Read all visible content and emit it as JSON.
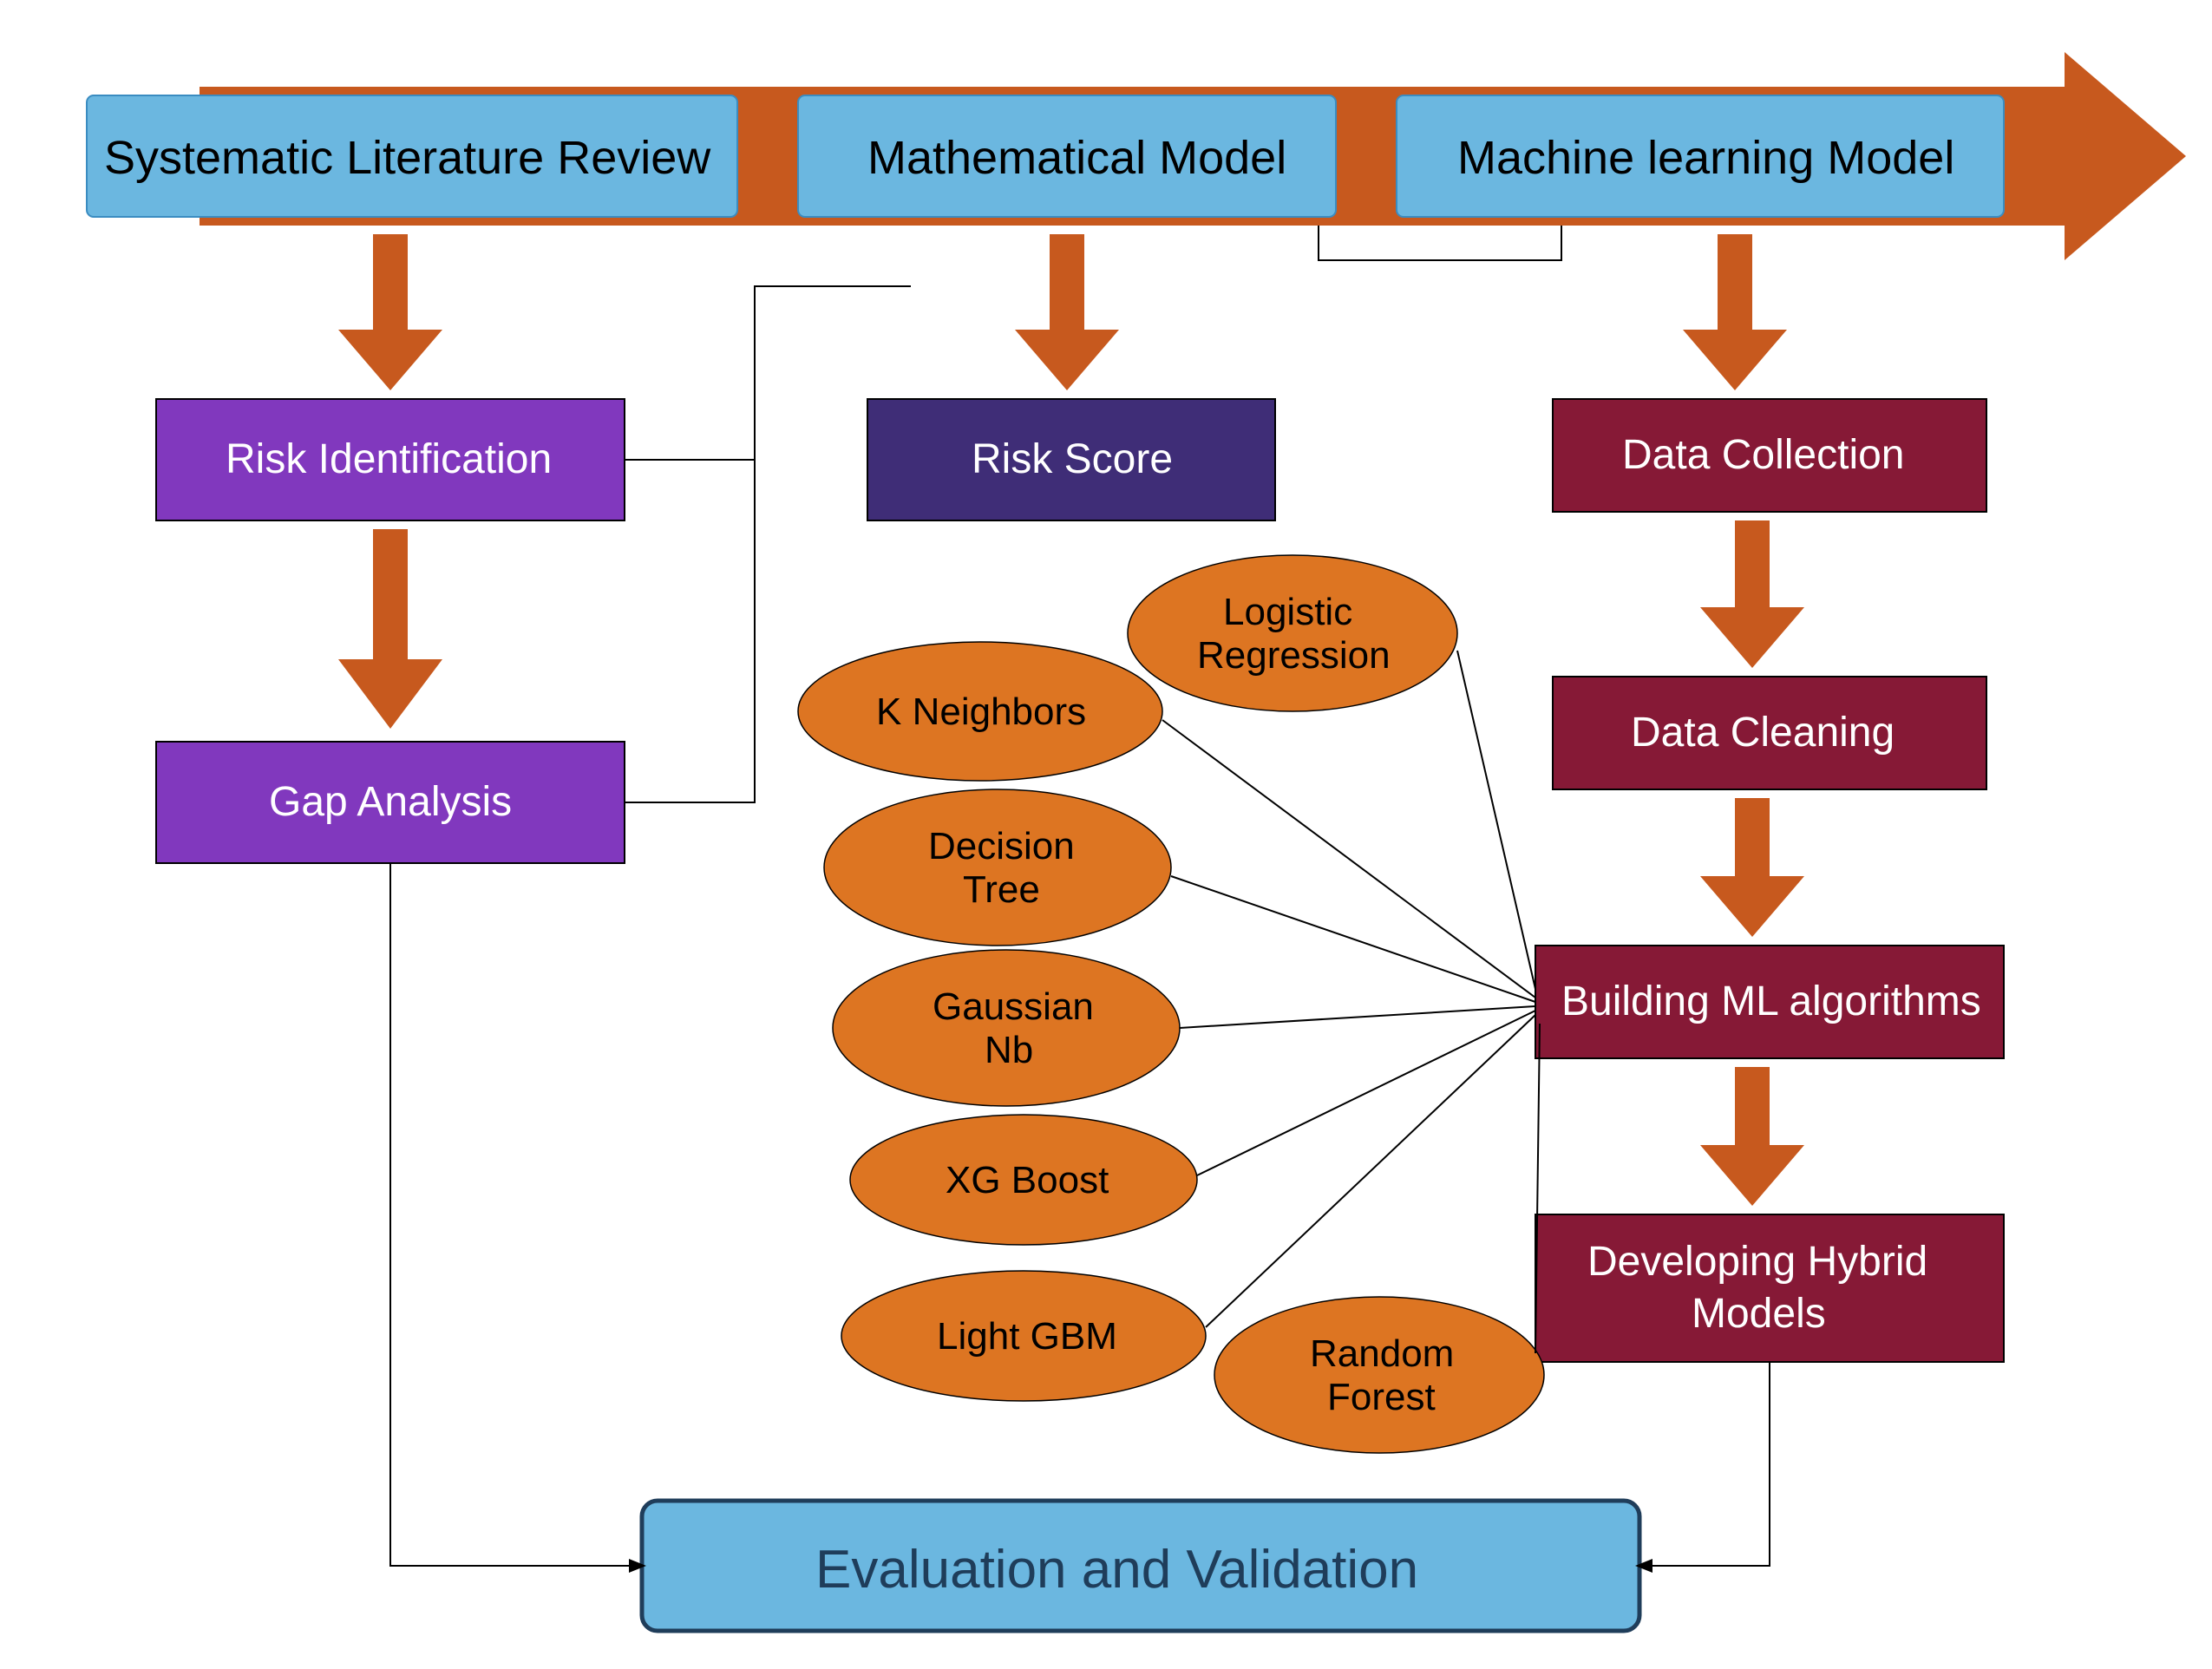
{
  "top": {
    "slr": "Systematic Literature Review",
    "math": "Mathematical Model",
    "ml": "Machine learning Model"
  },
  "left": {
    "risk_id": "Risk Identification",
    "gap": "Gap Analysis"
  },
  "mid": {
    "risk_score": "Risk Score"
  },
  "right": {
    "collect": "Data Collection",
    "clean": "Data Cleaning",
    "build": "Building ML algorithms",
    "hybrid_l1": "Developing Hybrid",
    "hybrid_l2": "Models"
  },
  "algos": {
    "lr_l1": "Logistic",
    "lr_l2": "Regression",
    "kn": "K Neighbors",
    "dt_l1": "Decision",
    "dt_l2": "Tree",
    "gn_l1": "Gaussian",
    "gn_l2": "Nb",
    "xgb": "XG Boost",
    "lgbm": "Light GBM",
    "rf_l1": "Random",
    "rf_l2": "Forest"
  },
  "bottom": {
    "eval": "Evaluation and Validation"
  }
}
